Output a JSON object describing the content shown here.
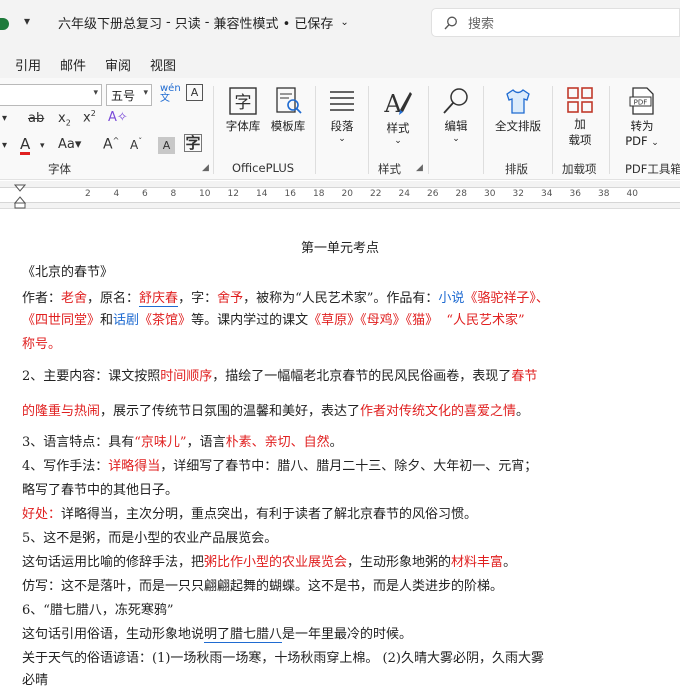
{
  "titlebar": {
    "doc_name": "六年级下册总复习",
    "sep1": "-",
    "mode": "只读",
    "sep2": "-",
    "status": "兼容性模式 • 已保存",
    "search_placeholder": "搜索"
  },
  "tabs": [
    "引用",
    "邮件",
    "审阅",
    "视图"
  ],
  "ribbon": {
    "font_size": "五号",
    "groups": {
      "font": "字体",
      "officeplus": "OfficePLUS",
      "style": "样式",
      "layout": "排版",
      "addins": "加载项",
      "pdf": "PDF工具箱"
    },
    "buttons": {
      "font_lib": "字体库",
      "template_lib": "模板库",
      "paragraph": "段落",
      "style": "样式",
      "edit": "编辑",
      "full_layout": "全文排版",
      "add_line1": "加",
      "add_line2": "载项",
      "to_pdf_line1": "转为",
      "to_pdf_line2": "PDF"
    },
    "pdf_icon_text": "PDF"
  },
  "ruler": {
    "numbers": [
      "2",
      "4",
      "6",
      "8",
      "10",
      "12",
      "14",
      "16",
      "18",
      "20",
      "22",
      "24",
      "26",
      "28",
      "30",
      "32",
      "34",
      "36",
      "38",
      "40"
    ]
  },
  "document": {
    "heading": "第一单元考点",
    "l1": "《北京的春节》",
    "l2": {
      "a": "作者：",
      "b": "老舍",
      "c": "，原名：",
      "d": "舒庆春",
      "e": "，字：",
      "f": "舍予",
      "g": "，被称为“人民艺术家”。作品有：",
      "h": "小说",
      "i": "《骆驼祥子》、"
    },
    "l3": {
      "a": "《四世同堂》",
      "b": "和",
      "c": "话剧",
      "d": "《茶馆》",
      "e": "等。课内学过的课文",
      "f": "《草原》《母鸡》《猫》",
      "g": "“人民艺术家”"
    },
    "l4": "称号。",
    "l5": {
      "a": "2、主要内容：课文按照",
      "b": "时间顺序",
      "c": "，描绘了一幅幅老北京春节的民风民俗画卷，表现了",
      "d": "春节"
    },
    "l6": {
      "a": "的隆重与热闹",
      "b": "，展示了传统节日氛围的温馨和美好，表达了",
      "c": "作者对传统文化的喜爱之情",
      "d": "。"
    },
    "l7": {
      "a": "3、语言特点：具有",
      "b": "“京味儿”",
      "c": "，语言",
      "d": "朴素、亲切、自然",
      "e": "。"
    },
    "l8": {
      "a": "4、写作手法：",
      "b": "详略得当",
      "c": "，详细写了春节中：腊八、腊月二十三、除夕、大年初一、元宵；"
    },
    "l9": "略写了春节中的其他日子。",
    "l10": {
      "a": "好处：",
      "b": "详略得当，主次分明，重点突出，有利于读者了解北京春节的风俗习惯。"
    },
    "l11": "5、这不是粥，而是小型的农业产品展览会。",
    "l12": {
      "a": "这句话运用比喻的修辞手法，把",
      "b": "粥比作小型的农业展览会",
      "c": "，生动形象地粥的",
      "d": "材料丰富",
      "e": "。"
    },
    "l13": "仿写：这不是落叶，而是一只只翩翩起舞的蝴蝶。这不是书，而是人类进步的阶梯。",
    "l14": "6、“腊七腊八，冻死寒鸦”",
    "l15": {
      "a": "这句话引用俗语，生动形象地说",
      "b": "明了腊七腊八",
      "c": "是一年里最冷的时候。"
    },
    "l16": "关于天气的俗语谚语：(1)一场秋雨一场寒，十场秋雨穿上棉。 (2)久晴大雾必阴，久雨大雾",
    "l17": "必晴"
  }
}
